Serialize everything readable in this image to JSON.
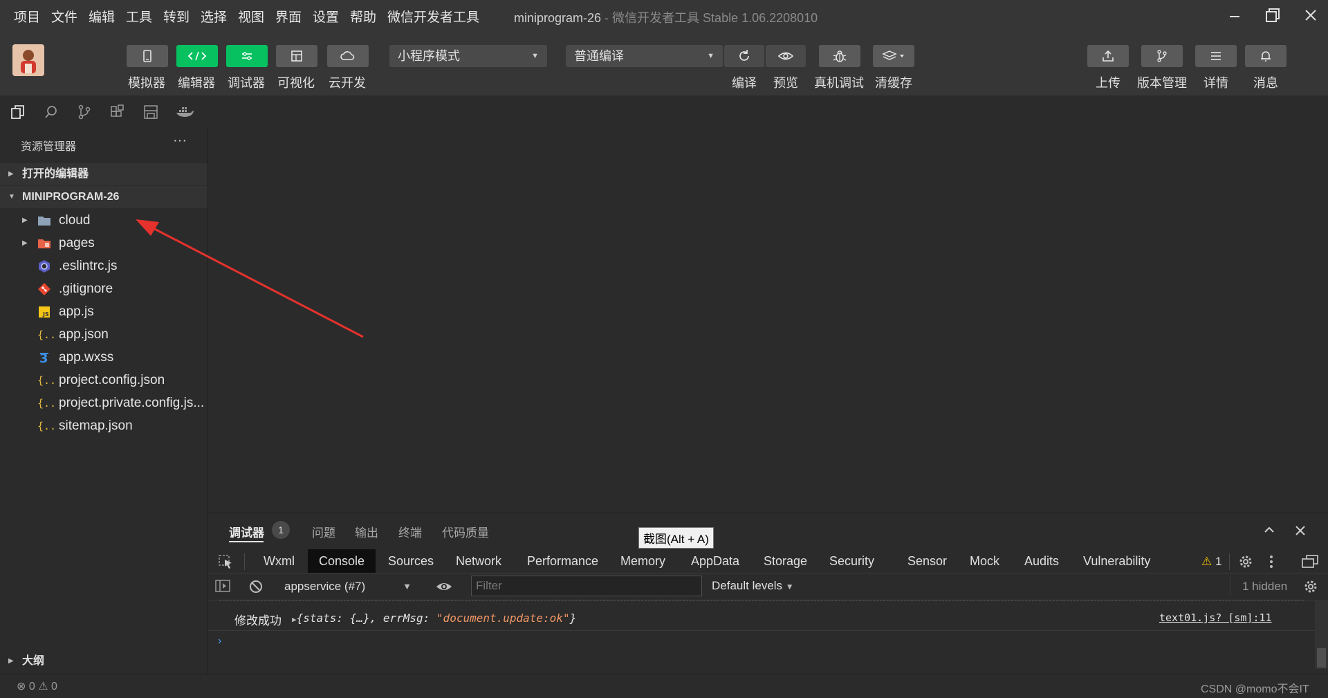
{
  "menu": [
    "项目",
    "文件",
    "编辑",
    "工具",
    "转到",
    "选择",
    "视图",
    "界面",
    "设置",
    "帮助",
    "微信开发者工具"
  ],
  "window": {
    "project": "miniprogram-26",
    "separator": " - ",
    "app": "微信开发者工具 Stable 1.06.2208010"
  },
  "toolbar": {
    "left_buttons": [
      {
        "label": "模拟器",
        "icon": "phone-icon"
      },
      {
        "label": "编辑器",
        "icon": "code-icon"
      },
      {
        "label": "调试器",
        "icon": "debug-toggle-icon"
      },
      {
        "label": "可视化",
        "icon": "layout-icon"
      },
      {
        "label": "云开发",
        "icon": "cloud-icon"
      }
    ],
    "mode_select": "小程序模式",
    "compile_select": "普通编译",
    "mid_buttons": [
      {
        "label": "编译",
        "icon": "refresh-icon"
      },
      {
        "label": "预览",
        "icon": "eye-icon"
      },
      {
        "label": "真机调试",
        "icon": "bug-icon"
      },
      {
        "label": "清缓存",
        "icon": "layers-icon"
      }
    ],
    "right_buttons": [
      {
        "label": "上传",
        "icon": "upload-icon"
      },
      {
        "label": "版本管理",
        "icon": "branch-icon"
      },
      {
        "label": "详情",
        "icon": "list-icon"
      },
      {
        "label": "消息",
        "icon": "bell-icon"
      }
    ]
  },
  "explorer": {
    "title": "资源管理器",
    "more": "···",
    "open_editors": "打开的编辑器",
    "project": "MINIPROGRAM-26",
    "files": [
      {
        "name": "cloud",
        "icon": "folder-icon",
        "expandable": true
      },
      {
        "name": "pages",
        "icon": "pages-folder-icon",
        "expandable": true
      },
      {
        "name": ".eslintrc.js",
        "icon": "eslint-icon",
        "expandable": false
      },
      {
        "name": ".gitignore",
        "icon": "git-icon",
        "expandable": false
      },
      {
        "name": "app.js",
        "icon": "js-icon",
        "expandable": false
      },
      {
        "name": "app.json",
        "icon": "json-icon",
        "expandable": false
      },
      {
        "name": "app.wxss",
        "icon": "css-icon",
        "expandable": false
      },
      {
        "name": "project.config.json",
        "icon": "json-icon",
        "expandable": false
      },
      {
        "name": "project.private.config.js...",
        "icon": "json-icon",
        "expandable": false
      },
      {
        "name": "sitemap.json",
        "icon": "json-icon",
        "expandable": false
      }
    ],
    "outline": "大纲"
  },
  "devtools": {
    "tabs": {
      "debugger": "调试器",
      "debugger_badge": "1",
      "problems": "问题",
      "output": "输出",
      "terminal": "终端",
      "quality": "代码质量"
    },
    "panels": [
      "Wxml",
      "Console",
      "Sources",
      "Network",
      "Performance",
      "Memory",
      "AppData",
      "Storage",
      "Security",
      "Sensor",
      "Mock",
      "Audits",
      "Vulnerability"
    ],
    "active_panel": "Console",
    "warnings": "1",
    "context": "appservice (#7)",
    "filter_placeholder": "Filter",
    "levels": "Default levels",
    "hidden": "1 hidden",
    "log": {
      "message": "修改成功",
      "object_text": "{stats: {…}, errMsg: ",
      "errmsg_value": "\"document.update:ok\"",
      "closing": "}",
      "source": "text01.js? [sm]:11"
    }
  },
  "tooltip": "截图(Alt + A)",
  "status": {
    "errors": "0",
    "warnings": "0",
    "watermark": "CSDN @momo不会IT"
  },
  "colors": {
    "accent_green": "#07c160",
    "annotation_arrow": "#e5322d",
    "string_orange": "#f29766",
    "link_blue": "#4a9eff"
  }
}
